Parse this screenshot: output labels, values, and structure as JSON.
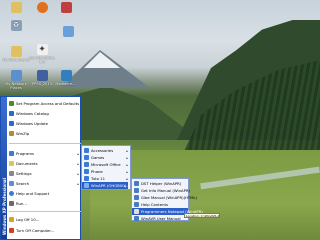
{
  "desktop_icons": [
    {
      "label": "",
      "icon": "folder-icon",
      "color": "#e0c060"
    },
    {
      "label": "",
      "icon": "firefox-icon",
      "color": "#e07020"
    },
    {
      "label": "",
      "icon": "recycle-icon",
      "color": "#8aa0b8"
    },
    {
      "label": "",
      "icon": "shortcut-icon",
      "color": "#c04040"
    },
    {
      "label": "My Documents",
      "icon": "documents-icon",
      "color": "#e0c060"
    },
    {
      "label": "Counter-Strike 1.6",
      "icon": "cs-icon",
      "color": "#f0f0f0"
    },
    {
      "label": "",
      "icon": "network-icon",
      "color": "#6aa0d8"
    },
    {
      "label": "My Network Places",
      "icon": "network-places-icon",
      "color": "#5a8fd0"
    },
    {
      "label": "PPSS_2013",
      "icon": "app-icon",
      "color": "#4060a0"
    },
    {
      "label": "Mediafire....",
      "icon": "mediafire-icon",
      "color": "#3080c0"
    }
  ],
  "start_menu": {
    "banner": "Windows XP Professional",
    "pinned": [
      {
        "label": "Set Program Access and Defaults",
        "color": "#4a8b2a"
      },
      {
        "label": "Windows Catalog",
        "color": "#2a6bc8"
      },
      {
        "label": "Windows Update",
        "color": "#2a6bc8"
      },
      {
        "label": "WinZip",
        "color": "#b58a2a"
      }
    ],
    "items": [
      {
        "label": "Programs",
        "color": "#3a7ad8",
        "arrow": "▸"
      },
      {
        "label": "Documents",
        "color": "#e0c060",
        "arrow": "▸"
      },
      {
        "label": "Settings",
        "color": "#888888",
        "arrow": "▸"
      },
      {
        "label": "Search",
        "color": "#5a8fd0",
        "arrow": "▸"
      },
      {
        "label": "Help and Support",
        "color": "#3a7ad8",
        "arrow": ""
      },
      {
        "label": "Run...",
        "color": "#6a6a6a",
        "arrow": ""
      }
    ],
    "bottom": [
      {
        "label": "Log Off 10...",
        "color": "#e0a020"
      },
      {
        "label": "Turn Off Computer...",
        "color": "#d04020"
      }
    ]
  },
  "programs_menu": {
    "items": [
      {
        "label": "Accessories",
        "arrow": "▸"
      },
      {
        "label": "Games",
        "arrow": "▸"
      },
      {
        "label": "Microsoft Office",
        "arrow": "▸"
      },
      {
        "label": "Phone",
        "arrow": "▸"
      },
      {
        "label": "Tuto 11",
        "arrow": "▸"
      },
      {
        "label": "WinAPR (OHOB00)...",
        "arrow": "▸"
      }
    ],
    "selected": 5
  },
  "app_submenu": {
    "items": [
      {
        "label": "DST Helper (WinAPR)"
      },
      {
        "label": "Get Info Manual (WinAPR)"
      },
      {
        "label": "Gibe Manual (WinAPR)(HTML)"
      },
      {
        "label": "Help Contents"
      },
      {
        "label": "Programmers Notepad (WinAPR)"
      },
      {
        "label": "WinAVR User Manual"
      }
    ],
    "selected": 4
  },
  "tooltip": "Location: C:\\WinAVR-20100110\\pn"
}
